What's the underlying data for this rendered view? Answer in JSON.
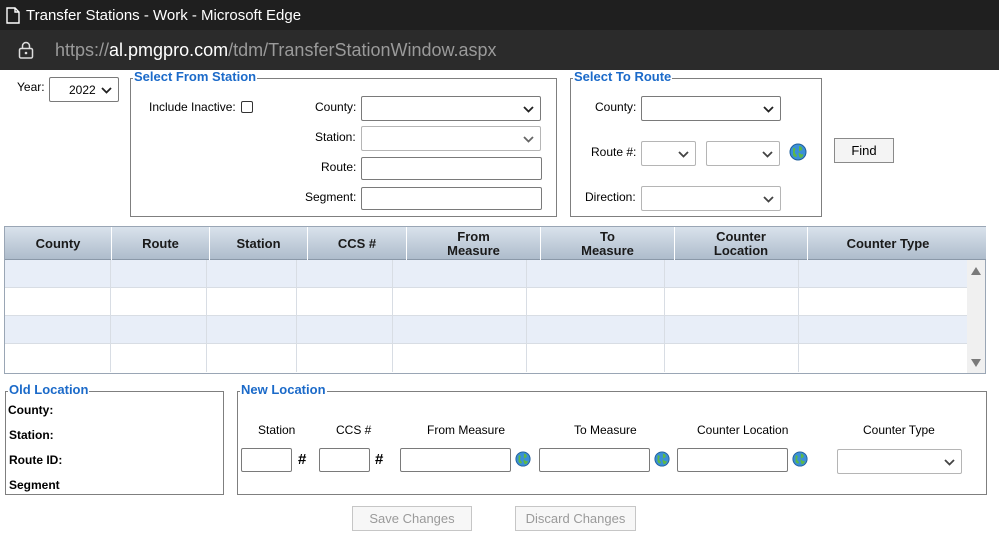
{
  "window": {
    "title": "Transfer Stations - Work - Microsoft Edge",
    "url_proto": "https://",
    "url_host": "al.pmgpro.com",
    "url_path": "/tdm/TransferStationWindow.aspx"
  },
  "year": {
    "label": "Year:",
    "value": "2022"
  },
  "from_station": {
    "legend": "Select From Station",
    "include_inactive_label": "Include Inactive:",
    "county_label": "County:",
    "station_label": "Station:",
    "route_label": "Route:",
    "segment_label": "Segment:",
    "county_value": "",
    "station_value": "",
    "route_value": "",
    "segment_value": ""
  },
  "to_route": {
    "legend": "Select To Route",
    "county_label": "County:",
    "route_label": "Route #:",
    "direction_label": "Direction:",
    "county_value": "",
    "route_value_1": "",
    "route_value_2": "",
    "direction_value": ""
  },
  "find_label": "Find",
  "grid": {
    "columns": [
      "County",
      "Route",
      "Station",
      "CCS #",
      "From\nMeasure",
      "To\nMeasure",
      "Counter\nLocation",
      "Counter Type"
    ],
    "rows": [
      [
        "",
        "",
        "",
        "",
        "",
        "",
        "",
        ""
      ],
      [
        "",
        "",
        "",
        "",
        "",
        "",
        "",
        ""
      ],
      [
        "",
        "",
        "",
        "",
        "",
        "",
        "",
        ""
      ],
      [
        "",
        "",
        "",
        "",
        "",
        "",
        "",
        ""
      ]
    ]
  },
  "old_location": {
    "legend": "Old Location",
    "county_label": "County:",
    "station_label": "Station:",
    "route_id_label": "Route ID:",
    "segment_label": "Segment"
  },
  "new_location": {
    "legend": "New Location",
    "station_label": "Station",
    "ccs_label": "CCS #",
    "from_measure_label": "From Measure",
    "to_measure_label": "To Measure",
    "counter_location_label": "Counter Location",
    "counter_type_label": "Counter Type",
    "hash": "#"
  },
  "save_label": "Save Changes",
  "discard_label": "Discard Changes",
  "colors": {
    "accent": "#1b6ac9",
    "titlebar": "#1f1f1f",
    "addressbar": "#2b2b2b"
  }
}
